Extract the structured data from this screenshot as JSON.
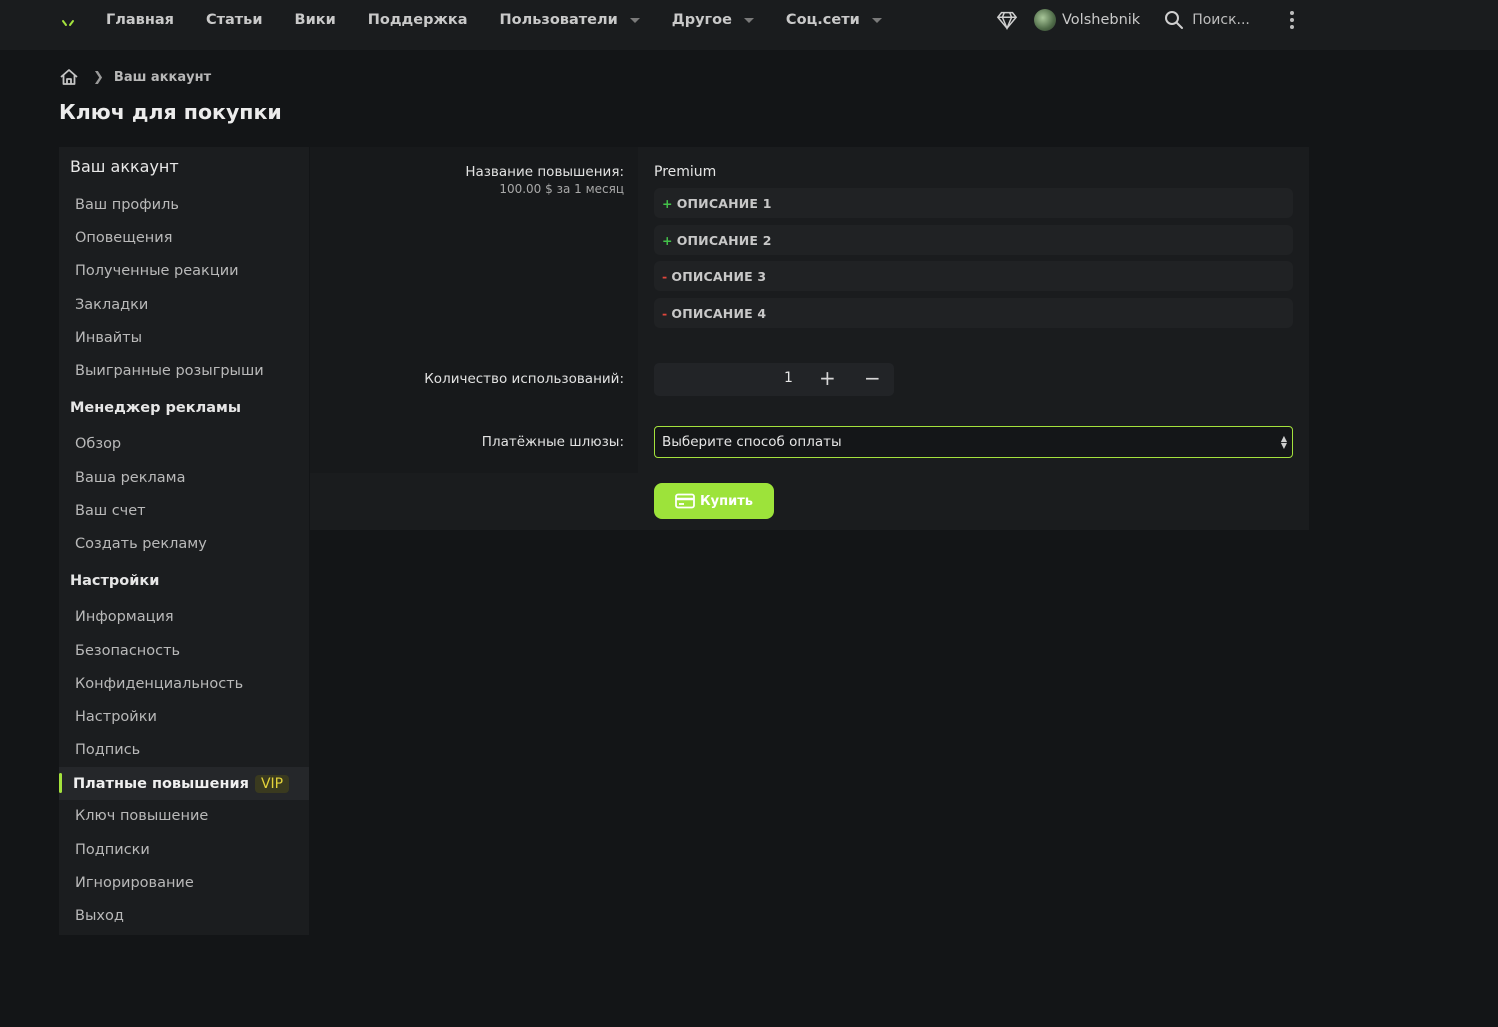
{
  "nav": {
    "items": [
      {
        "label": "Главная",
        "dropdown": false
      },
      {
        "label": "Статьи",
        "dropdown": false
      },
      {
        "label": "Вики",
        "dropdown": false
      },
      {
        "label": "Поддержка",
        "dropdown": false
      },
      {
        "label": "Пользователи",
        "dropdown": true
      },
      {
        "label": "Другое",
        "dropdown": true
      },
      {
        "label": "Соц.сети",
        "dropdown": true
      }
    ],
    "username": "Volshebnik",
    "search_label": "Поиск..."
  },
  "breadcrumb": {
    "item": "Ваш аккаунт"
  },
  "page_title": "Ключ для покупки",
  "sidebar": {
    "heading": "Ваш аккаунт",
    "account_items": [
      "Ваш профиль",
      "Оповещения",
      "Полученные реакции",
      "Закладки",
      "Инвайты",
      "Выигранные розыгрыши"
    ],
    "ads_heading": "Менеджер рекламы",
    "ads_items": [
      "Обзор",
      "Ваша реклама",
      "Ваш счет",
      "Создать рекламу"
    ],
    "settings_heading": "Настройки",
    "settings_items_before": [
      "Информация",
      "Безопасность",
      "Конфиденциальность",
      "Настройки",
      "Подпись"
    ],
    "active_item": "Платные повышения",
    "active_badge": "VIP",
    "settings_items_after": [
      "Ключ повышение",
      "Подписки",
      "Игнорирование",
      "Выход"
    ]
  },
  "form": {
    "upgrade_label": "Название повышения:",
    "upgrade_price": "100.00 $ за 1 месяц",
    "upgrade_name": "Premium",
    "descriptions": [
      {
        "sign": "+",
        "text": "ОПИСАНИЕ 1"
      },
      {
        "sign": "+",
        "text": "ОПИСАНИЕ 2"
      },
      {
        "sign": "-",
        "text": "ОПИСАНИЕ 3"
      },
      {
        "sign": "-",
        "text": "ОПИСАНИЕ 4"
      }
    ],
    "uses_label": "Количество использований:",
    "uses_value": "1",
    "gateway_label": "Платёжные шлюзы:",
    "gateway_selected": "Выберите способ оплаты",
    "buy_label": "Купить"
  },
  "colors": {
    "accent": "#a4e23d",
    "plus": "#43c24a",
    "minus": "#e0463c",
    "vip": "#e3d23a"
  }
}
